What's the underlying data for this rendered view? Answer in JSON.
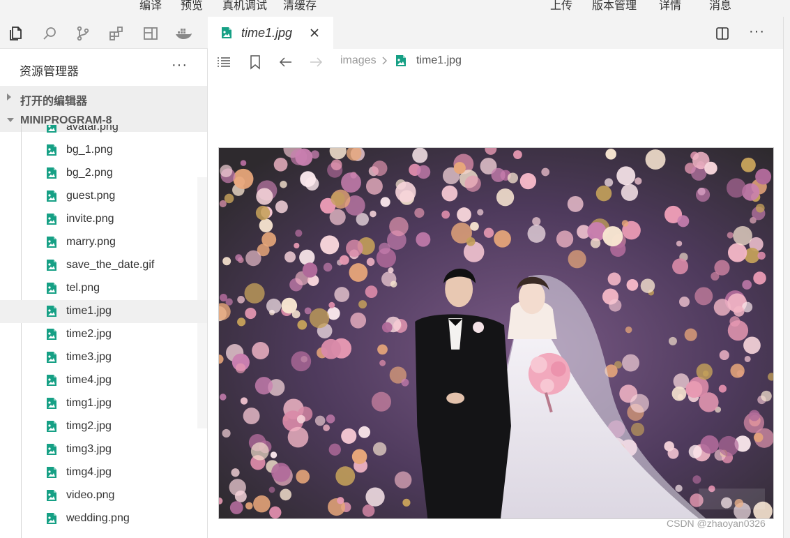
{
  "toolbar": {
    "compile": "编译",
    "preview": "预览",
    "device_debug": "真机调试",
    "clear_cache": "清缓存",
    "upload": "上传",
    "version": "版本管理",
    "details": "详情",
    "messages": "消息"
  },
  "activity_bar": [
    "files-icon",
    "search-icon",
    "source-control-icon",
    "extensions-icon",
    "panel-icon",
    "docker-icon"
  ],
  "sidebar": {
    "title": "资源管理器",
    "more": "···",
    "open_editors": "打开的编辑器",
    "project": "MINIPROGRAM-8",
    "files": [
      {
        "name": "avatar.png",
        "selected": false
      },
      {
        "name": "bg_1.png",
        "selected": false
      },
      {
        "name": "bg_2.png",
        "selected": false
      },
      {
        "name": "guest.png",
        "selected": false
      },
      {
        "name": "invite.png",
        "selected": false
      },
      {
        "name": "marry.png",
        "selected": false
      },
      {
        "name": "save_the_date.gif",
        "selected": false
      },
      {
        "name": "tel.png",
        "selected": false
      },
      {
        "name": "time1.jpg",
        "selected": true
      },
      {
        "name": "time2.jpg",
        "selected": false
      },
      {
        "name": "time3.jpg",
        "selected": false
      },
      {
        "name": "time4.jpg",
        "selected": false
      },
      {
        "name": "timg1.jpg",
        "selected": false
      },
      {
        "name": "timg2.jpg",
        "selected": false
      },
      {
        "name": "timg3.jpg",
        "selected": false
      },
      {
        "name": "timg4.jpg",
        "selected": false
      },
      {
        "name": "video.png",
        "selected": false
      },
      {
        "name": "wedding.png",
        "selected": false
      }
    ]
  },
  "editor": {
    "tab_label": "time1.jpg",
    "more": "···",
    "breadcrumb": {
      "folder": "images",
      "file": "time1.jpg"
    }
  },
  "colors": {
    "file_icon": "#16a085",
    "sidebar_bg": "#ffffff",
    "chrome_bg": "#f3f3f3"
  },
  "watermark": "CSDN @zhaoyan0326"
}
